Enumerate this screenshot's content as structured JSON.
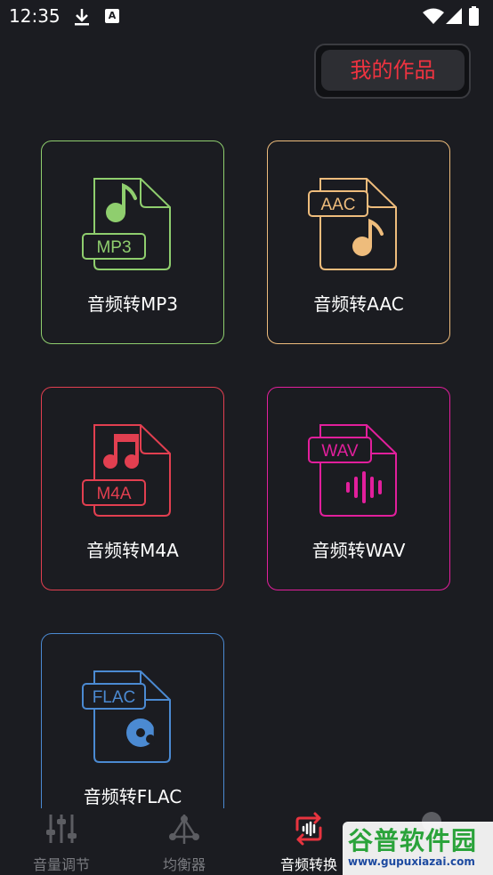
{
  "status_bar": {
    "time": "12:35",
    "icons": [
      "download-icon",
      "a-icon",
      "wifi-icon",
      "signal-icon",
      "battery-icon"
    ]
  },
  "header": {
    "my_works_label": "我的作品"
  },
  "formats": [
    {
      "label": "音频转MP3",
      "badge": "MP3",
      "color": "#8fce6e",
      "symbol": "music-note-icon"
    },
    {
      "label": "音频转AAC",
      "badge": "AAC",
      "color": "#eebc7c",
      "symbol": "music-note-icon"
    },
    {
      "label": "音频转M4A",
      "badge": "M4A",
      "color": "#e23f50",
      "symbol": "double-note-icon"
    },
    {
      "label": "音频转WAV",
      "badge": "WAV",
      "color": "#e21f9c",
      "symbol": "waveform-icon"
    },
    {
      "label": "音频转FLAC",
      "badge": "FLAC",
      "color": "#4b8ad2",
      "symbol": "disc-note-icon"
    }
  ],
  "bottom_nav": {
    "items": [
      {
        "label": "音量调节",
        "icon": "sliders-icon",
        "active": false
      },
      {
        "label": "均衡器",
        "icon": "equalizer-nodes-icon",
        "active": false
      },
      {
        "label": "音频转换",
        "icon": "convert-icon",
        "active": true
      }
    ],
    "active_color": "#e8343f"
  },
  "watermark": {
    "title": "谷普软件园",
    "url": "www.gupuxiazai.com"
  }
}
